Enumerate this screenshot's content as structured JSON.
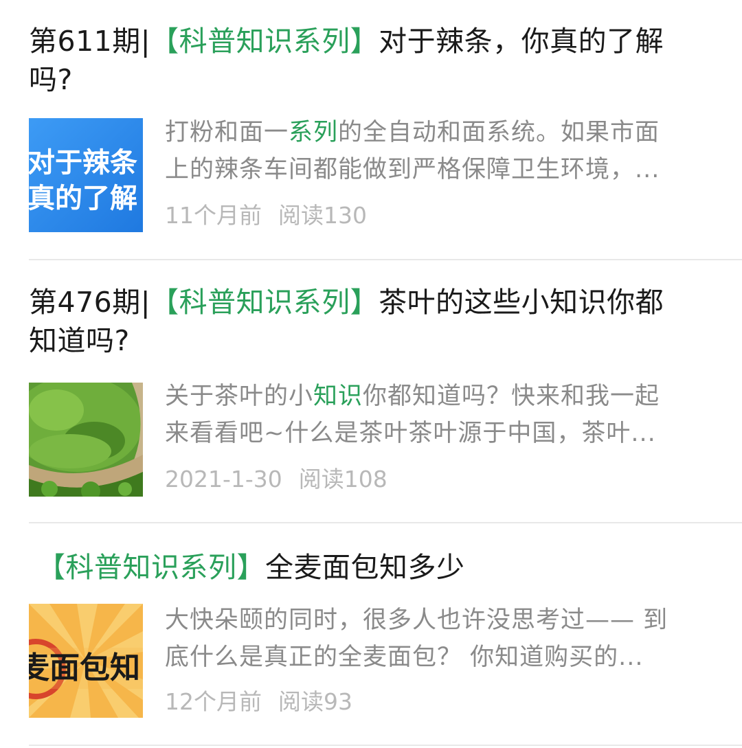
{
  "articles": [
    {
      "title_prefix": "第611期|",
      "tag": "【科普知识系列】",
      "title_rest_1": "对于辣条，你真的了解",
      "title_line2": "吗?",
      "summary_a": "打粉和面一",
      "summary_hl": "系列",
      "summary_b": "的全自动和面系统。如果市面",
      "summary_line2": "上的辣条车间都能做到严格保障卫生环境，...",
      "time": "11个月前",
      "reads": "阅读130",
      "thumb_line1": "对于辣条",
      "thumb_line2": "真的了解",
      "thumb_color": "#2f8ef0"
    },
    {
      "title_prefix": "第476期|",
      "tag": "【科普知识系列】",
      "title_rest_1": "茶叶的这些小知识你都",
      "title_line2": "知道吗?",
      "summary_a": "关于茶叶的小",
      "summary_hl": "知识",
      "summary_b": "你都知道吗？快来和我一起",
      "summary_line2": "来看看吧~什么是茶叶茶叶源于中国，茶叶...",
      "time": "2021-1-30",
      "reads": "阅读108",
      "thumb_color": "#4f8a2a"
    },
    {
      "tag": "【科普知识系列】",
      "title_rest_1": "全麦面包知多少",
      "summary_line1": "大快朵颐的同时，很多人也许没思考过—— 到",
      "summary_line2": "底什么是真正的全麦面包？ 你知道购买的...",
      "time": "12个月前",
      "reads": "阅读93",
      "thumb_text": "麦面包知",
      "thumb_color": "#f6b64a"
    }
  ],
  "colors": {
    "accent_green": "#2aa05a",
    "title_text": "#1a1a1a",
    "summary_text": "#8a8a8a",
    "meta_text": "#b8b8b8",
    "divider": "#e8e8e8"
  }
}
